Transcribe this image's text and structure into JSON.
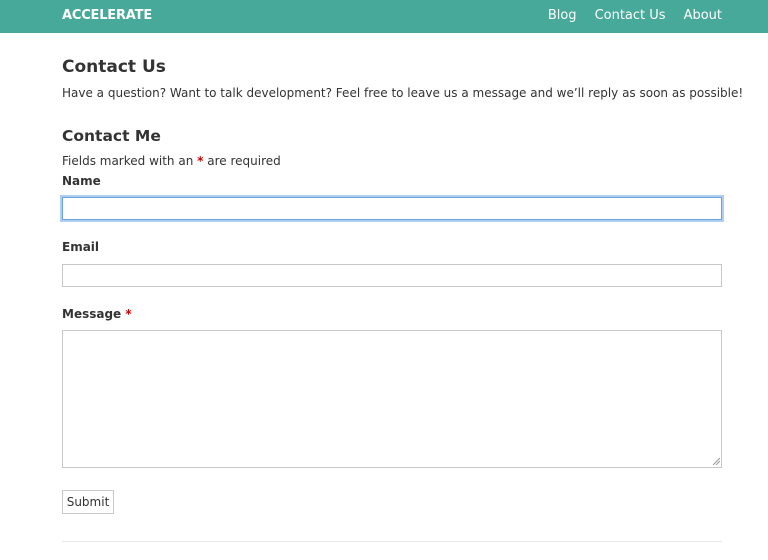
{
  "header": {
    "brand": "ACCELERATE",
    "nav": [
      {
        "label": "Blog"
      },
      {
        "label": "Contact Us"
      },
      {
        "label": "About"
      }
    ]
  },
  "main": {
    "title": "Contact Us",
    "intro": "Have a question? Want to talk development? Feel free to leave us a message and we’ll reply as soon as possible!",
    "form": {
      "title": "Contact Me",
      "required_note_prefix": "Fields marked with an",
      "required_marker": "*",
      "required_note_suffix": "are required",
      "fields": {
        "name": {
          "label": "Name",
          "value": "",
          "placeholder": ""
        },
        "email": {
          "label": "Email",
          "value": "",
          "placeholder": ""
        },
        "message": {
          "label": "Message",
          "required_marker": "*",
          "value": "",
          "placeholder": ""
        }
      },
      "submit_label": "Submit"
    }
  },
  "colors": {
    "header_bg": "#47a999",
    "required": "#cc0000",
    "focus_ring": "#6aa3e0"
  }
}
